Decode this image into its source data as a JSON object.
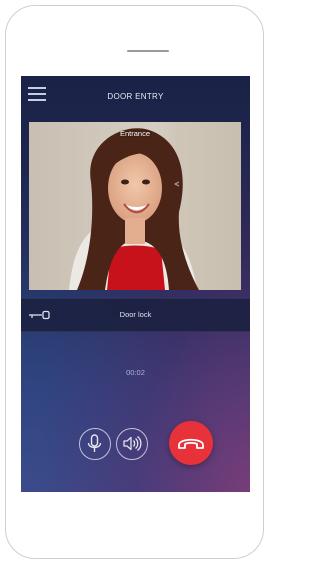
{
  "header": {
    "title": "DOOR ENTRY",
    "menu_icon": "hamburger-menu-icon"
  },
  "video": {
    "label": "Entrance"
  },
  "door_lock": {
    "label": "Door lock",
    "icon": "key-icon"
  },
  "call": {
    "timer": "00:02"
  },
  "controls": {
    "mic_icon": "microphone-icon",
    "speaker_icon": "speaker-icon",
    "end_call_icon": "hang-up-icon",
    "end_call_color": "#e8323a"
  }
}
